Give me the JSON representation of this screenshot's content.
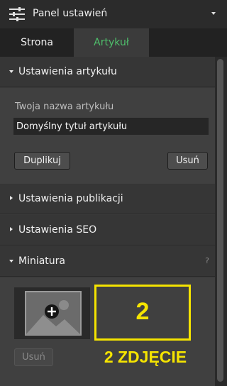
{
  "header": {
    "title": "Panel ustawień",
    "icon": "sliders-icon"
  },
  "tabs": [
    {
      "label": "Strona",
      "active": false
    },
    {
      "label": "Artykuł",
      "active": true
    }
  ],
  "accent_color": "#4fc06c",
  "article_settings": {
    "title": "Ustawienia artykułu",
    "field_label": "Twoja nazwa artykułu",
    "field_value": "Domyślny tytuł artykułu",
    "duplicate_label": "Duplikuj",
    "delete_label": "Usuń"
  },
  "sections": [
    {
      "title": "Ustawienia publikacji"
    },
    {
      "title": "Ustawienia SEO"
    }
  ],
  "thumbnail": {
    "title": "Miniatura",
    "help": "?",
    "delete_label": "Usuń",
    "icon": "add-image-icon"
  },
  "annotation": {
    "number": "2",
    "caption": "2 ZDJĘCIE",
    "color": "#f5e400"
  }
}
